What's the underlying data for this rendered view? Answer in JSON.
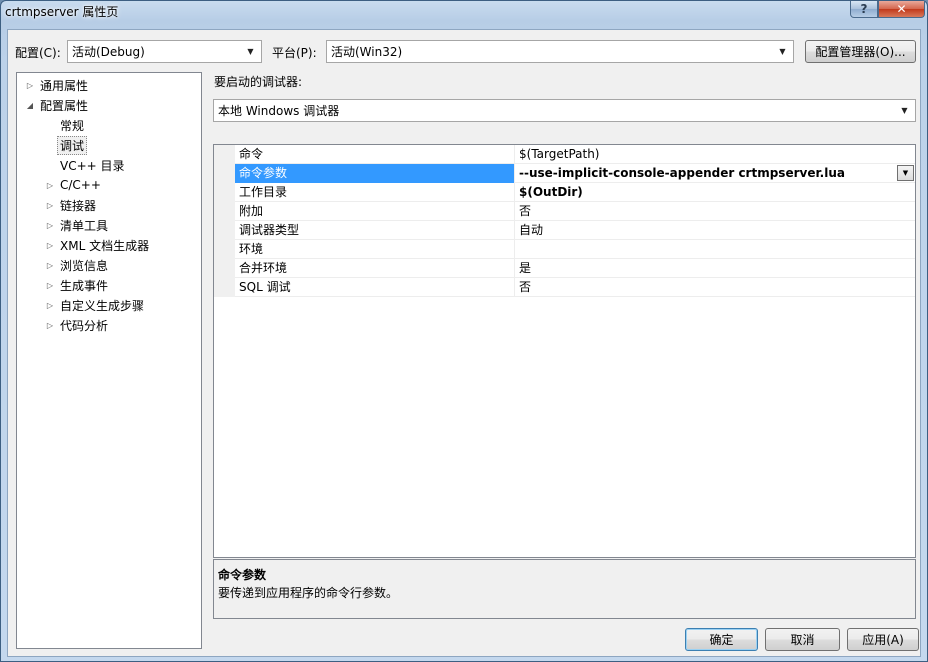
{
  "window": {
    "title": "crtmpserver 属性页",
    "help_glyph": "?",
    "close_glyph": "✕"
  },
  "toolbar": {
    "config_label": "配置(C):",
    "config_value": "活动(Debug)",
    "platform_label": "平台(P):",
    "platform_value": "活动(Win32)",
    "config_manager_label": "配置管理器(O)..."
  },
  "tree": {
    "items": [
      {
        "label": "通用属性",
        "level": 0,
        "expander": "▷"
      },
      {
        "label": "配置属性",
        "level": 0,
        "expander": "◢"
      },
      {
        "label": "常规",
        "level": 1,
        "expander": ""
      },
      {
        "label": "调试",
        "level": 1,
        "expander": "",
        "selected": true
      },
      {
        "label": "VC++ 目录",
        "level": 1,
        "expander": ""
      },
      {
        "label": "C/C++",
        "level": 1,
        "expander": "▷"
      },
      {
        "label": "链接器",
        "level": 1,
        "expander": "▷"
      },
      {
        "label": "清单工具",
        "level": 1,
        "expander": "▷"
      },
      {
        "label": "XML 文档生成器",
        "level": 1,
        "expander": "▷"
      },
      {
        "label": "浏览信息",
        "level": 1,
        "expander": "▷"
      },
      {
        "label": "生成事件",
        "level": 1,
        "expander": "▷"
      },
      {
        "label": "自定义生成步骤",
        "level": 1,
        "expander": "▷"
      },
      {
        "label": "代码分析",
        "level": 1,
        "expander": "▷"
      }
    ]
  },
  "debugger": {
    "label": "要启动的调试器:",
    "value": "本地 Windows 调试器"
  },
  "properties": [
    {
      "name": "命令",
      "value": "$(TargetPath)"
    },
    {
      "name": "命令参数",
      "value": "--use-implicit-console-appender  crtmpserver.lua",
      "selected": true,
      "bold": true
    },
    {
      "name": "工作目录",
      "value": "$(OutDir)",
      "bold": true
    },
    {
      "name": "附加",
      "value": "否"
    },
    {
      "name": "调试器类型",
      "value": "自动"
    },
    {
      "name": "环境",
      "value": ""
    },
    {
      "name": "合并环境",
      "value": "是"
    },
    {
      "name": "SQL 调试",
      "value": "否"
    }
  ],
  "description": {
    "title": "命令参数",
    "text": "要传递到应用程序的命令行参数。"
  },
  "buttons": {
    "ok": "确定",
    "cancel": "取消",
    "apply": "应用(A)"
  },
  "icons": {
    "dropdown": "chevron-down-icon",
    "expand": "triangle-right-icon",
    "collapse": "triangle-down-icon"
  },
  "colors": {
    "selection": "#3399ff",
    "window_chrome": "#b7cde6",
    "close_button": "#c1391c"
  }
}
